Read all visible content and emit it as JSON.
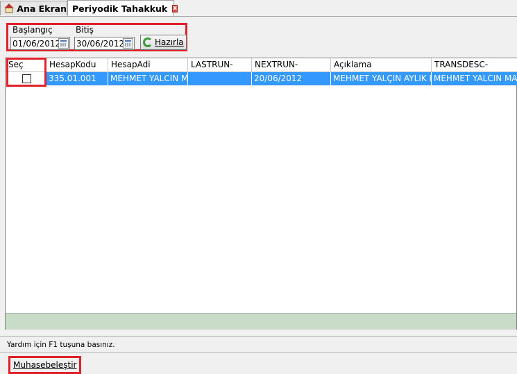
{
  "tabs": [
    {
      "label": "Ana Ekran",
      "icon": "home-icon"
    },
    {
      "label": "Periyodik Tahakkuk",
      "icon": "close-icon",
      "active": true
    }
  ],
  "filter": {
    "start_label": "Başlangıç",
    "start_value": "01/06/2012",
    "end_label": "Bitiş",
    "end_value": "30/06/2012",
    "prepare_button_label": "Hazırla"
  },
  "grid": {
    "columns": [
      "Seç",
      "HesapKodu",
      "HesapAdi",
      "LASTRUN-",
      "NEXTRUN-",
      "Açıklama",
      "TRANSDESC-"
    ],
    "rows": [
      {
        "selected": false,
        "HesapKodu": "335.01.001",
        "HesapAdi": "MEHMET YALCIN MA",
        "LASTRUN": "",
        "NEXTRUN": "20/06/2012",
        "Aciklama": "MEHMET YALÇIN AYLIK M",
        "TRANSDESC": "MEHMET YALCIN MA"
      }
    ]
  },
  "status": {
    "text": "Yardım için F1 tuşuna basınız."
  },
  "actions": {
    "post_button_label": "Muhasebeleştir"
  },
  "colors": {
    "highlight": "#e0202a",
    "row_selected": "#3399ff",
    "footer": "#c8dcc8"
  }
}
